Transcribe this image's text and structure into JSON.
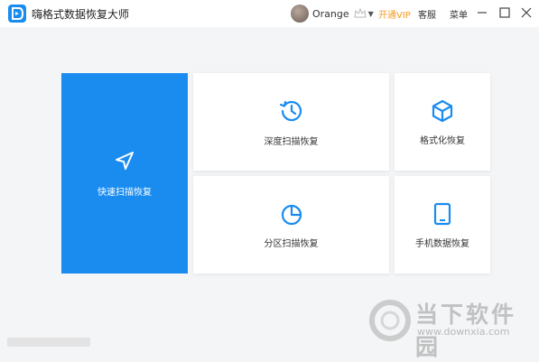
{
  "app": {
    "title": "嗨格式数据恢复大师"
  },
  "user": {
    "name": "Orange"
  },
  "header": {
    "vip_label": "开通VIP",
    "service_label": "客服",
    "menu_label": "菜单"
  },
  "cards": {
    "quick": "快速扫描恢复",
    "deep": "深度扫描恢复",
    "format": "格式化恢复",
    "partition": "分区扫描恢复",
    "phone": "手机数据恢复"
  },
  "watermark": {
    "text": "当下软件园",
    "url": "www.downxia.com"
  },
  "colors": {
    "accent": "#1a8cf0",
    "vip": "#f39a1e",
    "background": "#f4f5f7"
  }
}
